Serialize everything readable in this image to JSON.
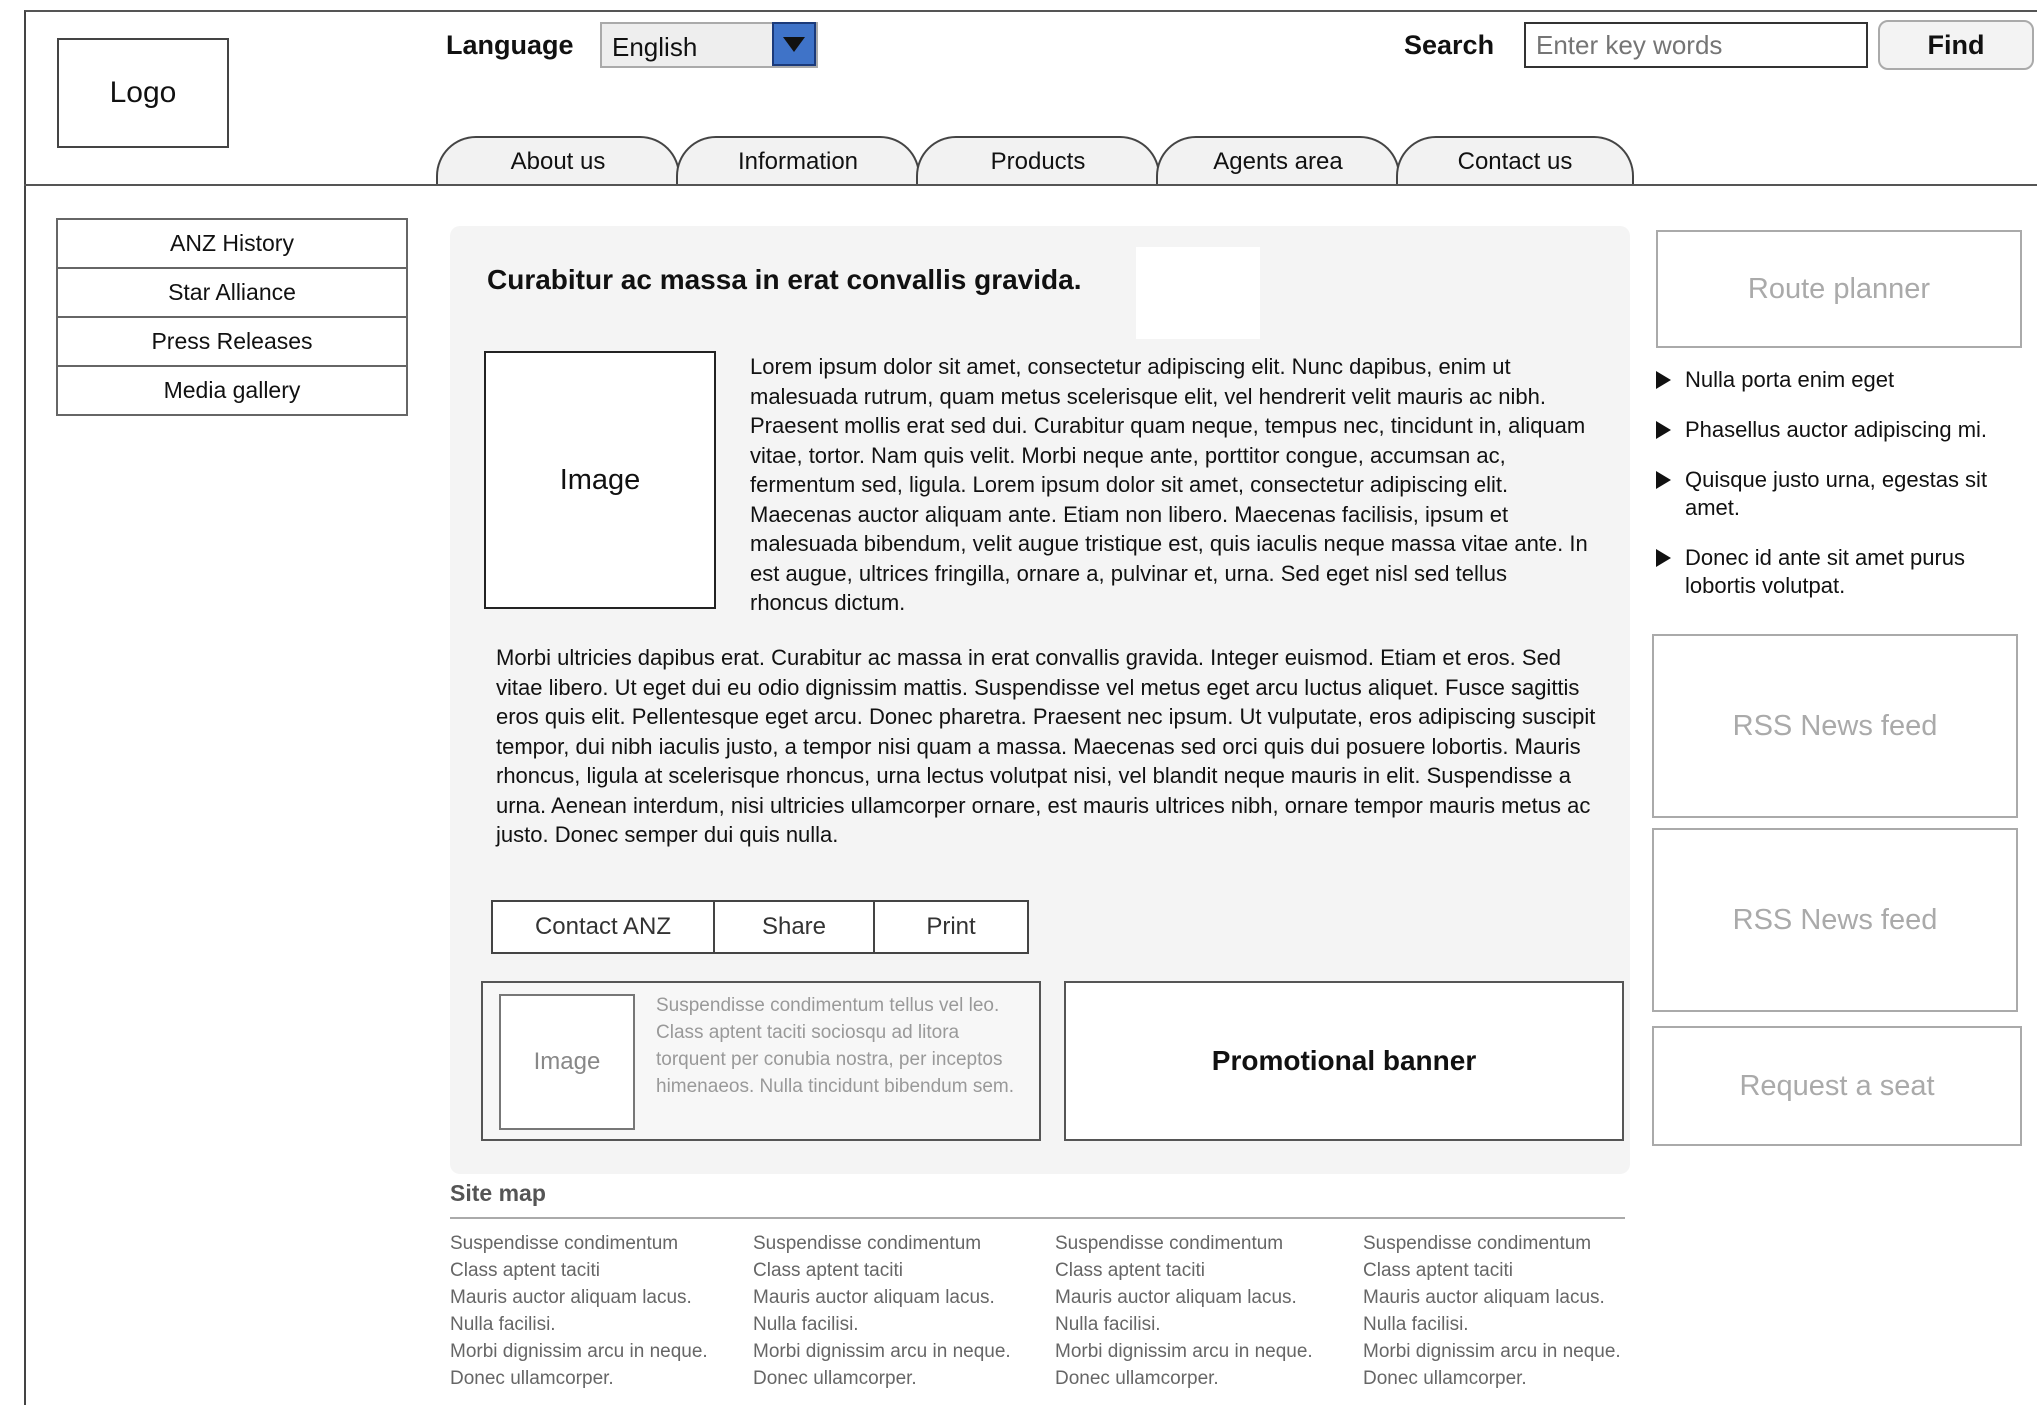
{
  "header": {
    "logo_label": "Logo",
    "language_label": "Language",
    "language_selected": "English",
    "search_label": "Search",
    "search_placeholder": "Enter key words",
    "find_label": "Find"
  },
  "tabs": [
    {
      "label": "About us"
    },
    {
      "label": "Information"
    },
    {
      "label": "Products"
    },
    {
      "label": "Agents area"
    },
    {
      "label": "Contact us"
    }
  ],
  "leftnav": [
    {
      "label": "ANZ History"
    },
    {
      "label": "Star Alliance"
    },
    {
      "label": "Press Releases"
    },
    {
      "label": "Media gallery"
    }
  ],
  "main": {
    "title": "Curabitur ac massa in erat convallis gravida.",
    "image_label": "Image",
    "para1": "Lorem ipsum dolor sit amet, consectetur adipiscing elit. Nunc dapibus, enim ut malesuada rutrum, quam metus scelerisque elit, vel hendrerit velit mauris ac nibh. Praesent mollis erat sed dui. Curabitur quam neque, tempus nec, tincidunt in, aliquam vitae, tortor. Nam quis velit. Morbi neque ante, porttitor congue, accumsan ac, fermentum sed, ligula. Lorem ipsum dolor sit amet, consectetur adipiscing elit. Maecenas auctor aliquam ante. Etiam non libero. Maecenas facilisis, ipsum et malesuada bibendum, velit augue tristique est, quis iaculis neque massa vitae ante. In est augue, ultrices fringilla, ornare a, pulvinar et, urna. Sed eget nisl sed tellus rhoncus dictum.",
    "para2": "Morbi ultricies dapibus erat. Curabitur ac massa in erat convallis gravida. Integer euismod. Etiam et eros. Sed vitae libero. Ut eget dui eu odio dignissim mattis. Suspendisse vel metus eget arcu luctus aliquet. Fusce sagittis eros quis elit. Pellentesque eget arcu. Donec pharetra. Praesent nec ipsum. Ut vulputate, eros adipiscing suscipit tempor, dui nibh iaculis justo, a tempor nisi quam a massa. Maecenas sed orci quis dui posuere lobortis. Mauris rhoncus, ligula at scelerisque rhoncus, urna lectus volutpat nisi, vel blandit neque mauris in elit. Suspendisse a urna. Aenean interdum, nisi ultricies ullamcorper ornare, est mauris ultrices nibh, ornare tempor mauris metus ac justo. Donec semper dui quis nulla.",
    "actions": [
      "Contact ANZ",
      "Share",
      "Print"
    ],
    "teaser_image_label": "Image",
    "teaser_text": "Suspendisse condimentum tellus vel leo. Class aptent taciti sociosqu ad litora torquent per conubia nostra, per inceptos himenaeos. Nulla tincidunt bibendum sem.",
    "promo_label": "Promotional banner"
  },
  "sitemap": {
    "title": "Site map",
    "columns": [
      [
        "Suspendisse condimentum",
        "Class aptent taciti",
        "Mauris auctor aliquam lacus.",
        "Nulla facilisi.",
        "Morbi dignissim arcu in neque.",
        "Donec ullamcorper."
      ],
      [
        "Suspendisse condimentum",
        "Class aptent taciti",
        "Mauris auctor aliquam lacus.",
        "Nulla facilisi.",
        "Morbi dignissim arcu in neque.",
        "Donec ullamcorper."
      ],
      [
        "Suspendisse condimentum",
        "Class aptent taciti",
        "Mauris auctor aliquam lacus.",
        "Nulla facilisi.",
        "Morbi dignissim arcu in neque.",
        "Donec ullamcorper."
      ],
      [
        "Suspendisse condimentum",
        "Class aptent taciti",
        "Mauris auctor aliquam lacus.",
        "Nulla facilisi.",
        "Morbi dignissim arcu in neque.",
        "Donec ullamcorper."
      ]
    ]
  },
  "right": {
    "route_planner": "Route planner",
    "bullets": [
      "Nulla porta enim eget",
      "Phasellus auctor adipiscing mi.",
      "Quisque justo urna, egestas sit amet.",
      "Donec id ante sit amet purus lobortis volutpat."
    ],
    "rss1": "RSS News feed",
    "rss2": "RSS News feed",
    "request_seat": "Request a seat"
  }
}
